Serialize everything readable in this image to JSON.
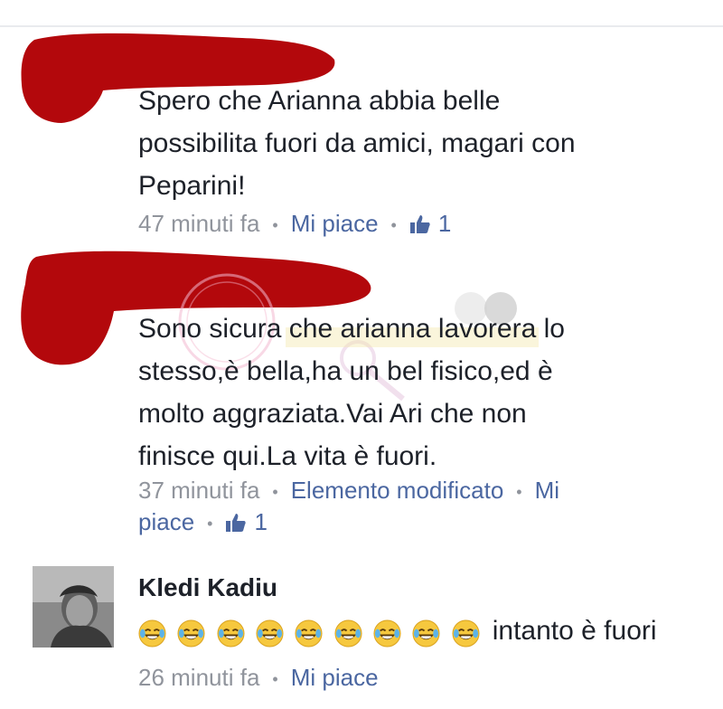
{
  "comments": [
    {
      "author": "",
      "text": [
        "Spero che Arianna abbia belle",
        "possibilita fuori da amici, magari con",
        "Peparini!"
      ],
      "time": "47 minuti fa",
      "like_action": "Mi piace",
      "like_count": "1"
    },
    {
      "author": "",
      "text": [
        "Sono sicura che arianna lavorera lo",
        "stesso,è bella,ha un bel fisico,ed è",
        "molto aggraziata.Vai Ari che non",
        "finisce qui.La vita è fuori."
      ],
      "time": "37 minuti fa",
      "edited": "Elemento modificato",
      "like_action_part1": "Mi",
      "like_action_part2": "piace",
      "like_count": "1"
    },
    {
      "author": "Kledi Kadiu",
      "emoji_icon": "face-with-tears-of-joy-icon",
      "emoji_count": 9,
      "text_after_emoji": "intanto è fuori",
      "time": "26 minuti fa",
      "like_action": "Mi piace"
    }
  ],
  "colors": {
    "text": "#1d2129",
    "meta": "#90949c",
    "link": "#4b67a1",
    "redaction": "#b3080c"
  }
}
